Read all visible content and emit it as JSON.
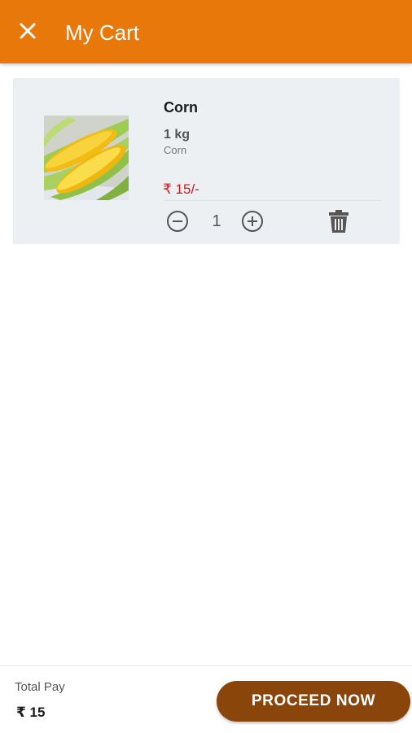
{
  "header": {
    "close_icon": "close-icon",
    "title": "My Cart",
    "background": "#e8780a"
  },
  "cart": {
    "items": [
      {
        "name": "Corn",
        "quantity_label": "1 kg",
        "subtitle": "Corn",
        "price": "₹ 15/-",
        "quantity": "1",
        "image": "corn-photo"
      }
    ]
  },
  "footer": {
    "total_label": "Total Pay",
    "total_value": "₹ 15",
    "proceed_label": "PROCEED NOW",
    "button_color": "#8a450b"
  },
  "colors": {
    "price": "#d8121b",
    "card_background": "#edf0f2"
  }
}
